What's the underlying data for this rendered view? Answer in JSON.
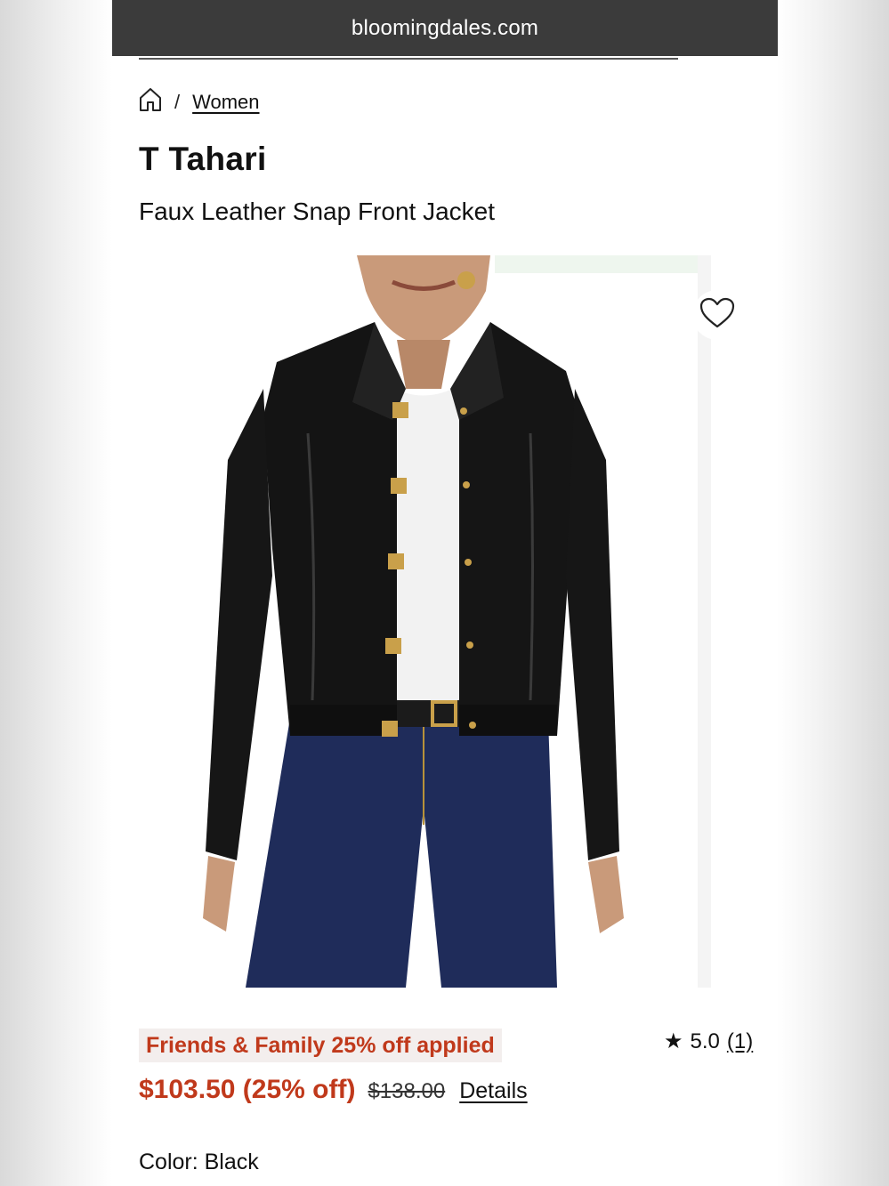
{
  "browser": {
    "url": "bloomingdales.com"
  },
  "breadcrumb": {
    "home_icon": "home-icon",
    "separator": "/",
    "category": "Women"
  },
  "product": {
    "brand": "T Tahari",
    "name": "Faux Leather Snap Front Jacket",
    "image_alt": "Model wearing black faux leather snap front jacket with white top and dark blue jeans",
    "wishlist_icon": "heart-outline-icon"
  },
  "promo": {
    "text": "Friends & Family 25% off applied"
  },
  "rating": {
    "icon": "star-icon",
    "star": "★",
    "value": "5.0",
    "count": "(1)"
  },
  "pricing": {
    "sale": "$103.50 (25% off)",
    "original": "$138.00",
    "details_label": "Details"
  },
  "color": {
    "label": "Color: Black"
  },
  "colors": {
    "promo_text": "#c0391b",
    "promo_bg": "#f3eeed",
    "url_bar": "#3b3b3b"
  }
}
